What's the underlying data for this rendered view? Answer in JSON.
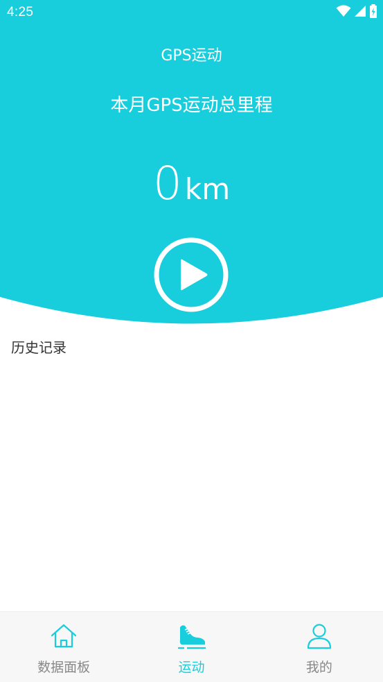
{
  "status_bar": {
    "time": "4:25",
    "icons": [
      "wifi-icon",
      "cellular-signal-icon",
      "battery-charging-icon"
    ]
  },
  "header": {
    "title": "GPS运动",
    "month_label": "本月GPS运动总里程",
    "distance_value": "0",
    "distance_unit": "km",
    "play_icon": "play-icon"
  },
  "history": {
    "title": "历史记录"
  },
  "bottom_nav": {
    "items": [
      {
        "label": "数据面板",
        "icon": "home-icon",
        "active": false
      },
      {
        "label": "运动",
        "icon": "sneaker-icon",
        "active": true
      },
      {
        "label": "我的",
        "icon": "person-icon",
        "active": false
      }
    ]
  },
  "colors": {
    "accent": "#18cedc",
    "background": "#ffffff",
    "nav_background": "#f7f7f7",
    "nav_inactive_text": "#888888",
    "history_text": "#333333"
  }
}
